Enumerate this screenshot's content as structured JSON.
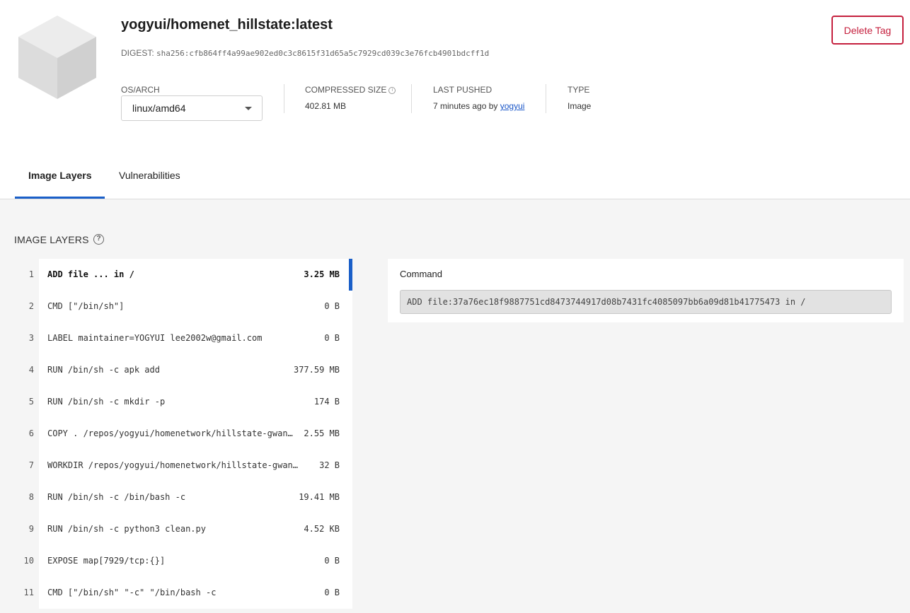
{
  "header": {
    "title": "yogyui/homenet_hillstate:latest",
    "digest_label": "DIGEST:",
    "digest_value": "sha256:cfb864ff4a99ae902ed0c3c8615f31d65a5c7929cd039c3e76fcb4901bdcff1d",
    "delete_button": "Delete Tag"
  },
  "meta": {
    "os_arch_label": "OS/ARCH",
    "os_arch_value": "linux/amd64",
    "compressed_size_label": "COMPRESSED SIZE",
    "compressed_size_value": "402.81 MB",
    "last_pushed_label": "LAST PUSHED",
    "last_pushed_value": "7 minutes ago by",
    "last_pushed_user": "yogyui",
    "type_label": "TYPE",
    "type_value": "Image"
  },
  "tabs": [
    {
      "label": "Image Layers",
      "active": true
    },
    {
      "label": "Vulnerabilities",
      "active": false
    }
  ],
  "layers_section": {
    "title": "IMAGE LAYERS",
    "help_icon": "question-circle-icon",
    "selected_index": 0
  },
  "layers": [
    {
      "num": "1",
      "command": "ADD file ... in /",
      "size": "3.25 MB"
    },
    {
      "num": "2",
      "command": "CMD [\"/bin/sh\"]",
      "size": "0 B"
    },
    {
      "num": "3",
      "command": "LABEL maintainer=YOGYUI lee2002w@gmail.com",
      "size": "0 B"
    },
    {
      "num": "4",
      "command": "RUN /bin/sh -c apk add",
      "size": "377.59 MB"
    },
    {
      "num": "5",
      "command": "RUN /bin/sh -c mkdir -p",
      "size": "174 B"
    },
    {
      "num": "6",
      "command": "COPY . /repos/yogyui/homenetwork/hillstate-gwan…",
      "size": "2.55 MB"
    },
    {
      "num": "7",
      "command": "WORKDIR /repos/yogyui/homenetwork/hillstate-gwangg…",
      "size": "32 B"
    },
    {
      "num": "8",
      "command": "RUN /bin/sh -c /bin/bash -c",
      "size": "19.41 MB"
    },
    {
      "num": "9",
      "command": "RUN /bin/sh -c python3 clean.py",
      "size": "4.52 KB"
    },
    {
      "num": "10",
      "command": "EXPOSE map[7929/tcp:{}]",
      "size": "0 B"
    },
    {
      "num": "11",
      "command": "CMD [\"/bin/sh\" \"-c\" \"/bin/bash -c",
      "size": "0 B"
    }
  ],
  "command_panel": {
    "label": "Command",
    "value": "ADD file:37a76ec18f9887751cd8473744917d08b7431fc4085097bb6a09d81b41775473 in /"
  },
  "colors": {
    "accent": "#1a5fc8",
    "danger": "#c5203e",
    "link": "#1a56c8"
  }
}
